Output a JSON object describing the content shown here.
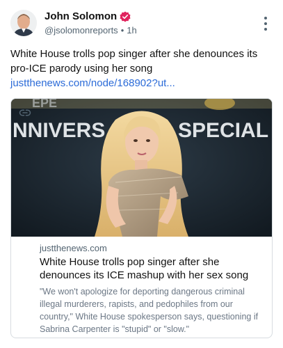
{
  "author": {
    "name": "John Solomon",
    "handle": "@jsolomonreports",
    "separator": "•",
    "time": "1h",
    "verified_color": "#e0245e"
  },
  "post": {
    "text": "White House trolls pop singer after she denounces its pro-ICE parody using her song ",
    "link_text": "justthenews.com/node/168902?ut..."
  },
  "card": {
    "image_banner_text_left": "NNIVERS",
    "image_banner_text_right": "SPECIAL",
    "image_banner_top": "EPE",
    "domain": "justthenews.com",
    "title": "White House trolls pop singer after she denounces its ICE mashup with her sex song",
    "description": "\"We won't apologize for deporting dangerous criminal illegal murderers, rapists, and pedophiles from our country,\" White House spokesperson says, questioning if Sabrina Carpenter is \"stupid\" or \"slow.\""
  },
  "icons": {
    "more": "more-vertical-icon",
    "link": "link-icon",
    "verified": "verified-badge-icon"
  },
  "colors": {
    "link": "#2b6bd8",
    "secondary_text": "#536471",
    "card_border": "#d7dce0"
  }
}
